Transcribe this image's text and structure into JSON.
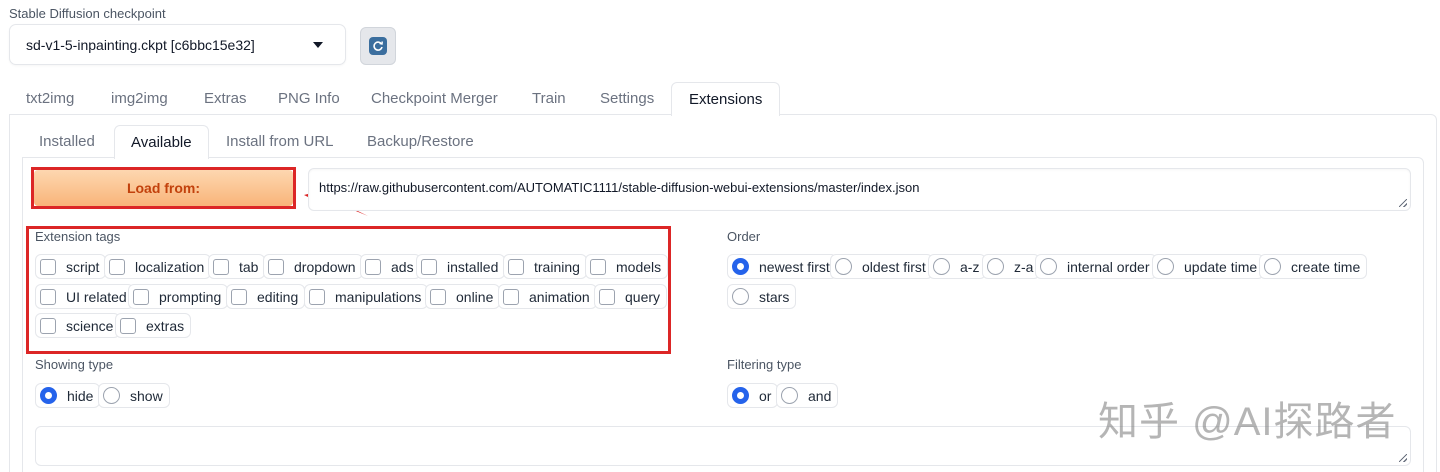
{
  "checkpoint": {
    "label": "Stable Diffusion checkpoint",
    "value": "sd-v1-5-inpainting.ckpt [c6bbc15e32]",
    "refresh_icon": "refresh-icon"
  },
  "tabs": [
    "txt2img",
    "img2img",
    "Extras",
    "PNG Info",
    "Checkpoint Merger",
    "Train",
    "Settings",
    "Extensions"
  ],
  "active_tab": "Extensions",
  "subtabs": [
    "Installed",
    "Available",
    "Install from URL",
    "Backup/Restore"
  ],
  "active_subtab": "Available",
  "load": {
    "button": "Load from:",
    "url": "https://raw.githubusercontent.com/AUTOMATIC1111/stable-diffusion-webui-extensions/master/index.json"
  },
  "extension_tags": {
    "label": "Extension tags",
    "items": [
      "script",
      "localization",
      "tab",
      "dropdown",
      "ads",
      "installed",
      "training",
      "models",
      "UI related",
      "prompting",
      "editing",
      "manipulations",
      "online",
      "animation",
      "query",
      "science",
      "extras"
    ]
  },
  "order": {
    "label": "Order",
    "items": [
      "newest first",
      "oldest first",
      "a-z",
      "z-a",
      "internal order",
      "update time",
      "create time",
      "stars"
    ],
    "selected": "newest first"
  },
  "showing_type": {
    "label": "Showing type",
    "items": [
      "hide",
      "show"
    ],
    "selected": "hide"
  },
  "filtering_type": {
    "label": "Filtering type",
    "items": [
      "or",
      "and"
    ],
    "selected": "or"
  },
  "watermark": "知乎 @AI探路者",
  "colors": {
    "highlight": "#dc2626",
    "accent": "#2563eb",
    "load_button": "#f9b479"
  }
}
